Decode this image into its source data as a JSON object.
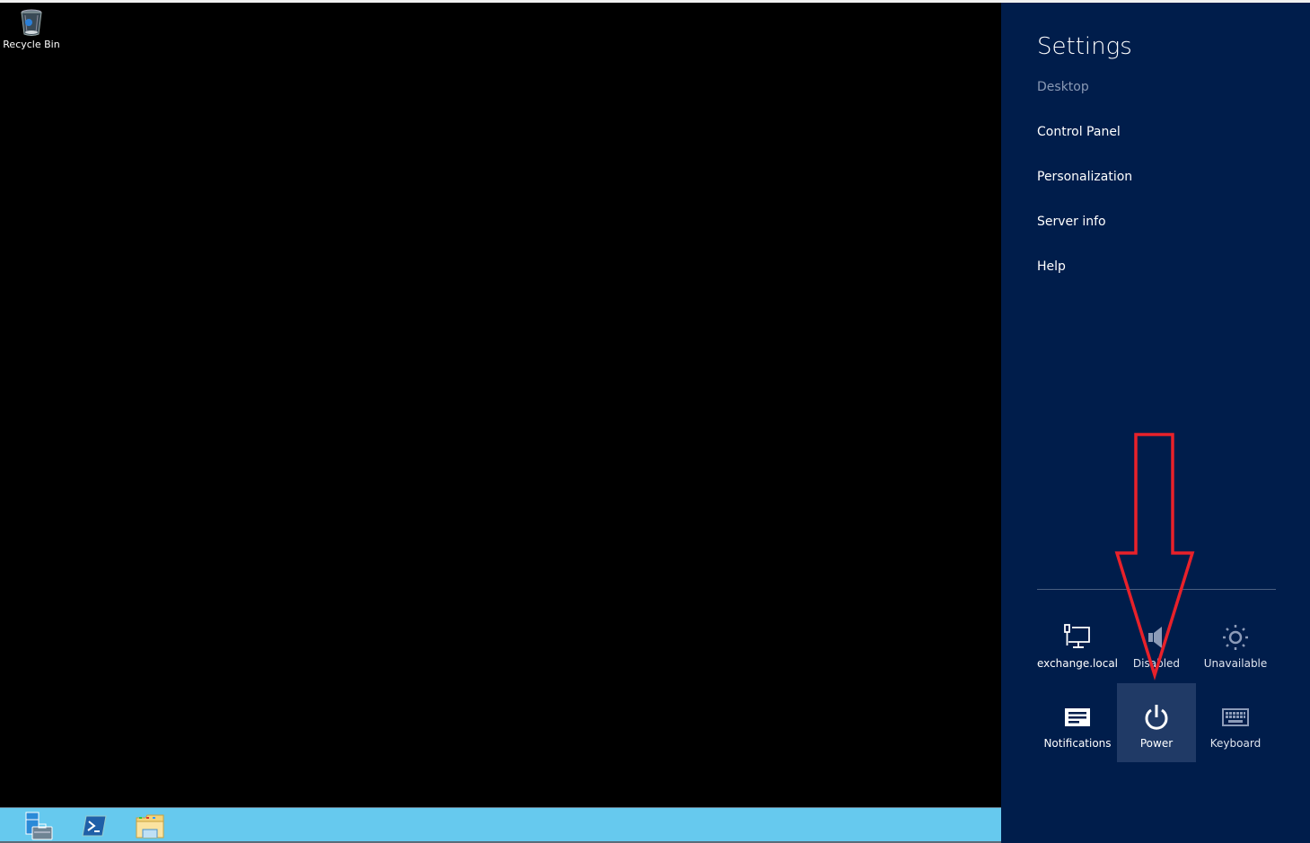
{
  "desktop": {
    "icons": [
      {
        "label": "Recycle Bin",
        "icon": "recycle-bin-icon"
      }
    ]
  },
  "taskbar": {
    "pinned": [
      {
        "name": "server-manager",
        "icon": "server-manager-icon"
      },
      {
        "name": "powershell",
        "icon": "powershell-icon"
      },
      {
        "name": "file-explorer",
        "icon": "file-explorer-icon"
      }
    ],
    "colors": {
      "background": "#66c9ee"
    }
  },
  "charm": {
    "title": "Settings",
    "subtitle": "Desktop",
    "items": [
      {
        "label": "Control Panel"
      },
      {
        "label": "Personalization"
      },
      {
        "label": "Server info"
      },
      {
        "label": "Help"
      }
    ],
    "tiles": [
      {
        "label": "exchange.local",
        "icon": "network-icon"
      },
      {
        "label": "Disabled",
        "icon": "volume-icon"
      },
      {
        "label": "Unavailable",
        "icon": "brightness-icon"
      },
      {
        "label": "Notifications",
        "icon": "notifications-icon"
      },
      {
        "label": "Power",
        "icon": "power-icon",
        "active": true
      },
      {
        "label": "Keyboard",
        "icon": "keyboard-icon"
      }
    ],
    "colors": {
      "background": "#001d4b",
      "active_tile": "#203a66",
      "annotation_arrow": "#e8212a"
    }
  }
}
